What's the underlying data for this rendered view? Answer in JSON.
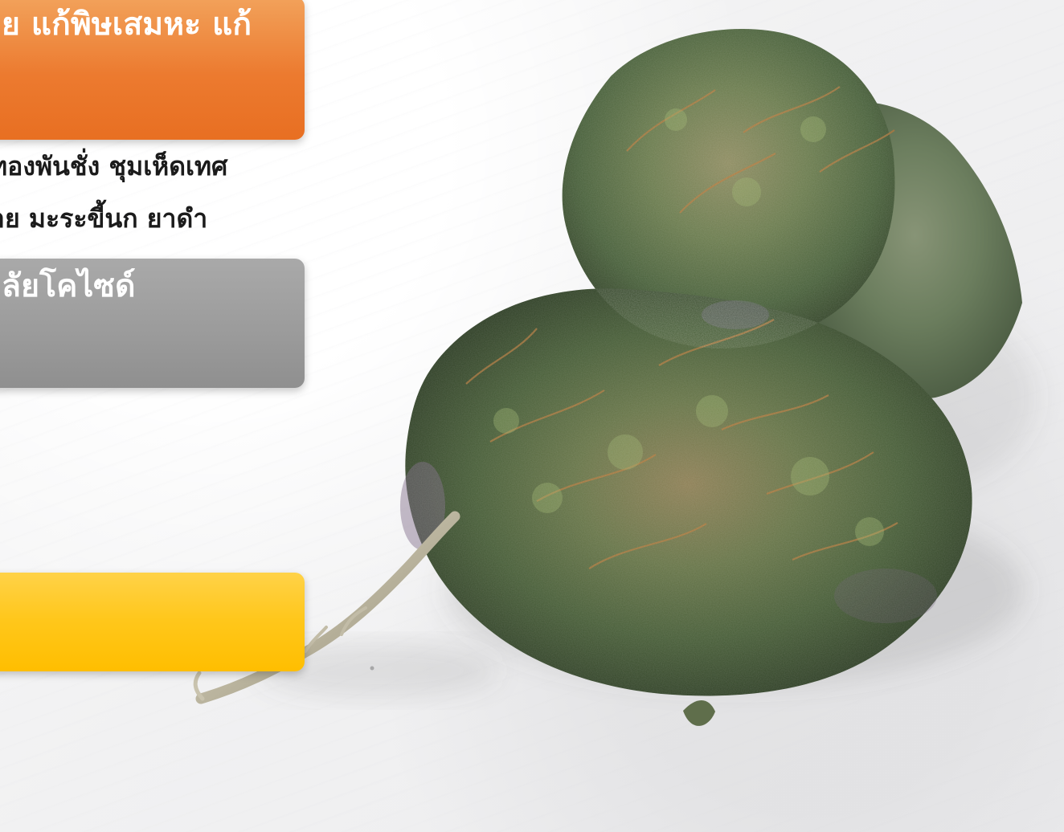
{
  "slide": {
    "callouts": [
      {
        "text": "ย แก้พิษเสมหะ แก้",
        "color": "#ec7a2f"
      },
      {
        "text": "ลัยโคไซด์",
        "color": "#9b9b9b"
      },
      {
        "text": "",
        "color": "#ffc300"
      }
    ],
    "body_lines": [
      "ทองพันชั่ง ชุมเห็ดเทศ",
      "าย มะระขี้นก ยาดำ"
    ]
  }
}
